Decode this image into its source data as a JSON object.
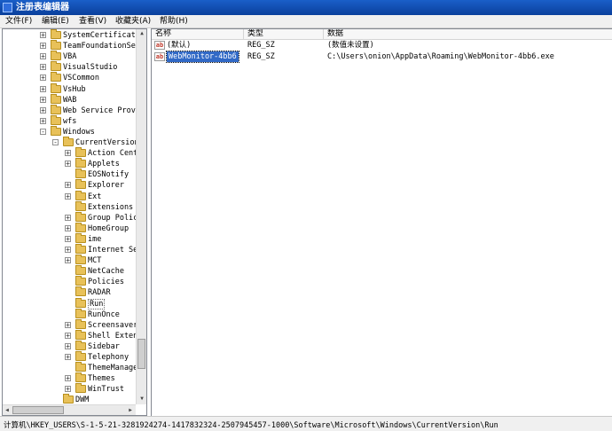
{
  "window": {
    "title": "注册表编辑器"
  },
  "menu": [
    "文件(F)",
    "编辑(E)",
    "查看(V)",
    "收藏夹(A)",
    "帮助(H)"
  ],
  "tree": [
    {
      "label": "SystemCertificates",
      "expander": "+",
      "level": 1
    },
    {
      "label": "TeamFoundationServer",
      "expander": "+",
      "level": 1
    },
    {
      "label": "VBA",
      "expander": "+",
      "level": 1
    },
    {
      "label": "VisualStudio",
      "expander": "+",
      "level": 1
    },
    {
      "label": "VSCommon",
      "expander": "+",
      "level": 1
    },
    {
      "label": "VsHub",
      "expander": "+",
      "level": 1
    },
    {
      "label": "WAB",
      "expander": "+",
      "level": 1
    },
    {
      "label": "Web Service Providers",
      "expander": "+",
      "level": 1
    },
    {
      "label": "wfs",
      "expander": "+",
      "level": 1
    },
    {
      "label": "Windows",
      "expander": "-",
      "level": 1
    },
    {
      "label": "CurrentVersion",
      "expander": "-",
      "level": 2
    },
    {
      "label": "Action Center",
      "expander": "+",
      "level": 3
    },
    {
      "label": "Applets",
      "expander": "+",
      "level": 3
    },
    {
      "label": "EOSNotify",
      "expander": "",
      "level": 3
    },
    {
      "label": "Explorer",
      "expander": "+",
      "level": 3
    },
    {
      "label": "Ext",
      "expander": "+",
      "level": 3
    },
    {
      "label": "Extensions",
      "expander": "",
      "level": 3
    },
    {
      "label": "Group Policy",
      "expander": "+",
      "level": 3
    },
    {
      "label": "HomeGroup",
      "expander": "+",
      "level": 3
    },
    {
      "label": "ime",
      "expander": "+",
      "level": 3
    },
    {
      "label": "Internet Settings",
      "expander": "+",
      "level": 3
    },
    {
      "label": "MCT",
      "expander": "+",
      "level": 3
    },
    {
      "label": "NetCache",
      "expander": "",
      "level": 3
    },
    {
      "label": "Policies",
      "expander": "",
      "level": 3
    },
    {
      "label": "RADAR",
      "expander": "",
      "level": 3
    },
    {
      "label": "Run",
      "expander": "",
      "level": 3,
      "selected": true
    },
    {
      "label": "RunOnce",
      "expander": "",
      "level": 3
    },
    {
      "label": "Screensavers",
      "expander": "+",
      "level": 3
    },
    {
      "label": "Shell Extensions",
      "expander": "+",
      "level": 3
    },
    {
      "label": "Sidebar",
      "expander": "+",
      "level": 3
    },
    {
      "label": "Telephony",
      "expander": "+",
      "level": 3
    },
    {
      "label": "ThemeManager",
      "expander": "",
      "level": 3
    },
    {
      "label": "Themes",
      "expander": "+",
      "level": 3
    },
    {
      "label": "WinTrust",
      "expander": "+",
      "level": 3
    },
    {
      "label": "DWM",
      "expander": "",
      "level": 2
    }
  ],
  "columns": [
    "名称",
    "类型",
    "数据"
  ],
  "values": [
    {
      "name": "(默认)",
      "type": "REG_SZ",
      "data": "(数值未设置)",
      "icon": "ab",
      "selected": false
    },
    {
      "name": "WebMonitor-4bb6",
      "type": "REG_SZ",
      "data": "C:\\Users\\onion\\AppData\\Roaming\\WebMonitor-4bb6.exe",
      "icon": "ab",
      "selected": true
    }
  ],
  "status": "计算机\\HKEY_USERS\\S-1-5-21-3281924274-1417832324-2507945457-1000\\Software\\Microsoft\\Windows\\CurrentVersion\\Run"
}
